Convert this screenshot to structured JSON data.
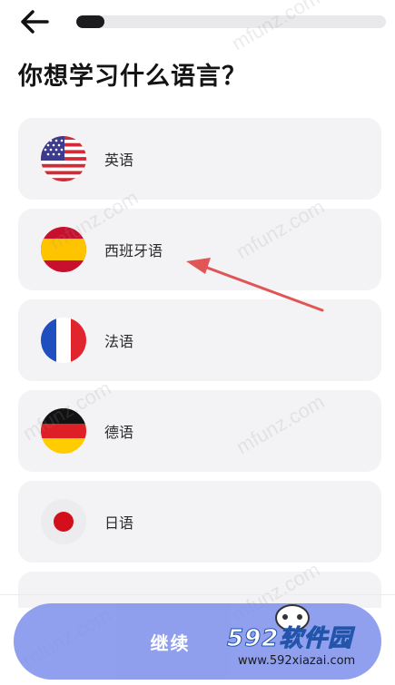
{
  "header": {
    "back_icon": "arrow-left-icon",
    "progress_fraction": 0.09
  },
  "page": {
    "title": "你想学习什么语言？"
  },
  "languages": [
    {
      "label": "英语",
      "flag": "us-flag-icon"
    },
    {
      "label": "西班牙语",
      "flag": "spain-flag-icon"
    },
    {
      "label": "法语",
      "flag": "france-flag-icon"
    },
    {
      "label": "德语",
      "flag": "germany-flag-icon"
    },
    {
      "label": "日语",
      "flag": "japan-flag-icon"
    }
  ],
  "footer": {
    "continue_label": "继续"
  },
  "watermark": {
    "site_text": "mfunz.com",
    "logo_brand_num": "592",
    "logo_brand_text": "软件园",
    "logo_domain": "www.592xiazai.com"
  },
  "colors": {
    "accent": "#7c8fec",
    "card_bg": "#f3f3f5",
    "arrow": "#e05555"
  }
}
